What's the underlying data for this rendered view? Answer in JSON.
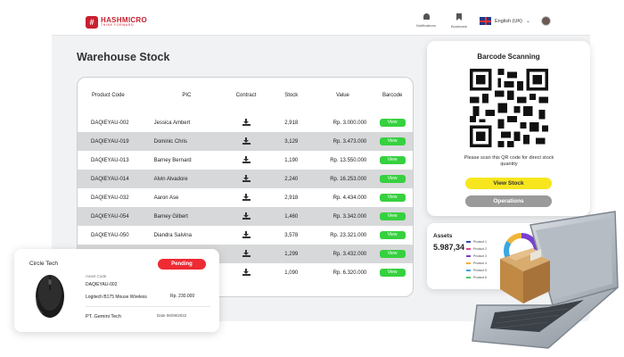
{
  "header": {
    "brand_name": "HASHMICRO",
    "brand_tagline": "THINK FORWARD",
    "notifications_label": "Notifications",
    "bookmark_label": "Bookmark",
    "language_label": "English (UK)"
  },
  "page": {
    "title": "Warehouse Stock"
  },
  "table": {
    "headers": [
      "Product Code",
      "PIC",
      "Contract",
      "Stock",
      "Value",
      "Barcode"
    ],
    "view_label": "View",
    "rows": [
      {
        "code": "DAQIEYAU-002",
        "pic": "Jessica Ambert",
        "stock": "2,918",
        "value": "Rp. 3.000.000"
      },
      {
        "code": "DAQIEYAU-019",
        "pic": "Dominic Chris",
        "stock": "3,129",
        "value": "Rp. 3.473.000"
      },
      {
        "code": "DAQIEYAU-013",
        "pic": "Barney Bernard",
        "stock": "1,190",
        "value": "Rp. 13.550.000"
      },
      {
        "code": "DAQIEYAU-014",
        "pic": "Alvin Alvadore",
        "stock": "2,240",
        "value": "Rp. 16.253.000"
      },
      {
        "code": "DAQIEYAU-032",
        "pic": "Aaron Ase",
        "stock": "2,918",
        "value": "Rp. 4.434.000"
      },
      {
        "code": "DAQIEYAU-054",
        "pic": "Barney Gilbert",
        "stock": "1,460",
        "value": "Rp. 3.342.000"
      },
      {
        "code": "DAQIEYAU-050",
        "pic": "Diandra Salvina",
        "stock": "3,578",
        "value": "Rp. 23.321.000"
      },
      {
        "code": "",
        "pic": "",
        "stock": "1,299",
        "value": "Rp. 3.432.000"
      },
      {
        "code": "",
        "pic": "",
        "stock": "1,090",
        "value": "Rp. 6.320.000"
      }
    ]
  },
  "barcode": {
    "title": "Barcode Scanning",
    "note": "Please scan this QR code for direct stock quantity",
    "view_stock_label": "View Stock",
    "operations_label": "Operations"
  },
  "assets": {
    "title": "Assets",
    "value": "5.987,34",
    "legend": [
      {
        "label": "Product 1",
        "color": "#2b4fa8"
      },
      {
        "label": "Product 2",
        "color": "#e24b8e"
      },
      {
        "label": "Product 3",
        "color": "#7a3fd1"
      },
      {
        "label": "Product 4",
        "color": "#f0b43a"
      },
      {
        "label": "Product 5",
        "color": "#3aa7e2"
      },
      {
        "label": "Product 6",
        "color": "#4cc964"
      }
    ]
  },
  "asset_card": {
    "name": "Circle Tech",
    "status": "Pending",
    "code_label": "Asset Code",
    "code": "DAQIEYAU-002",
    "product": "Logitech B175 Mouse Wireless",
    "price": "Rp. 230.000",
    "company": "PT. Gemini Tech",
    "date": "Date 06/09/2022"
  }
}
